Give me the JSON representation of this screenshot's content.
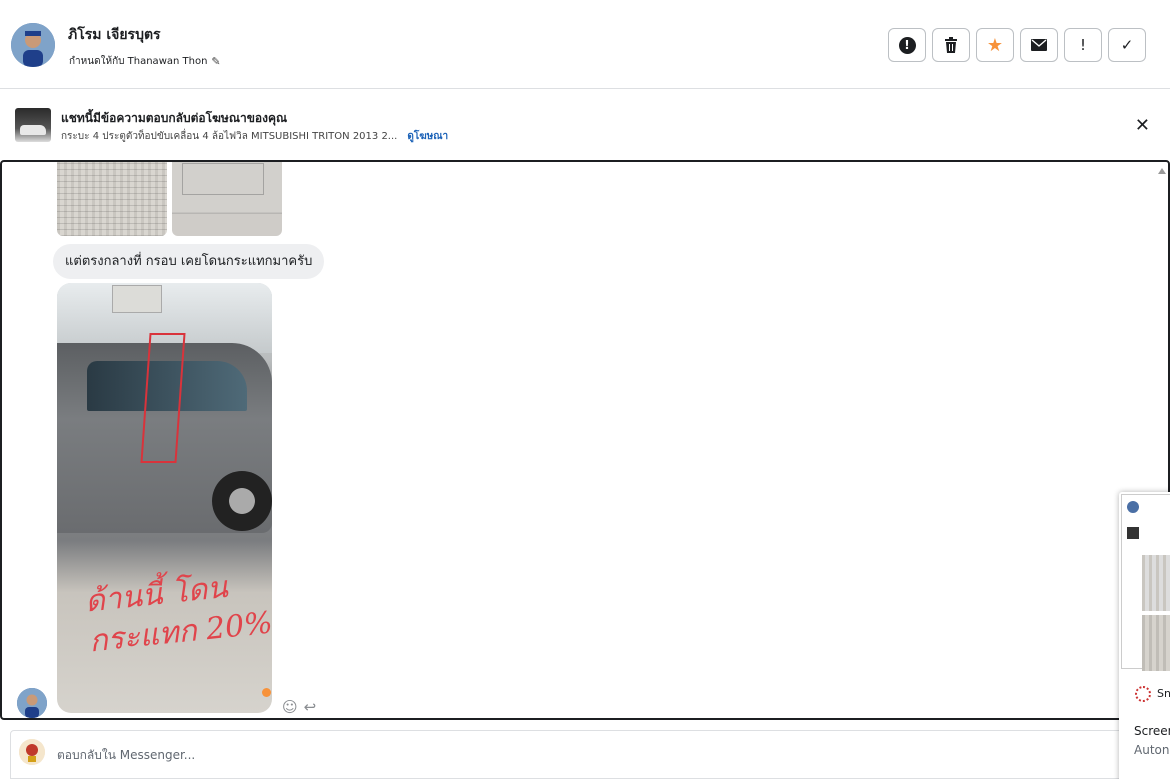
{
  "header": {
    "name": "ภิโรม เจียรบุตร",
    "assigned_to": "กำหนดให้กับ Thanawan Thon",
    "actions": [
      {
        "name": "report-button",
        "icon": "alert-circle-icon"
      },
      {
        "name": "delete-button",
        "icon": "trash-icon"
      },
      {
        "name": "star-button",
        "icon": "star-icon"
      },
      {
        "name": "mark-unread-button",
        "icon": "envelope-icon"
      },
      {
        "name": "mark-important-button",
        "icon": "exclamation-icon"
      },
      {
        "name": "done-button",
        "icon": "checkmark-icon"
      }
    ]
  },
  "ad_banner": {
    "title": "แชทนี้มีข้อความตอบกลับต่อโฆษณาของคุณ",
    "subtitle": "กระบะ 4 ประตูตัวท็อปขับเคลื่อน 4 ล้อไฟวิล MITSUBISHI TRITON 2013 2...",
    "link": "ดูโฆษณา"
  },
  "chat": {
    "message_text": "แต่ตรงกลางที่ กรอบ เคยโดนกระแทกมาครับ",
    "photo_handwriting_line1": "ด้านนี้ โดน",
    "photo_handwriting_line2": "กระแทก 20%"
  },
  "composer": {
    "placeholder": "ตอบกลับใน Messenger..."
  },
  "preview": {
    "label": "Sn",
    "title": "Screen",
    "subtitle": "Auton"
  },
  "colors": {
    "accent_link": "#1d63b8",
    "star": "#f7923a",
    "bubble_bg": "#eeeff1",
    "border": "#dddfe2"
  }
}
